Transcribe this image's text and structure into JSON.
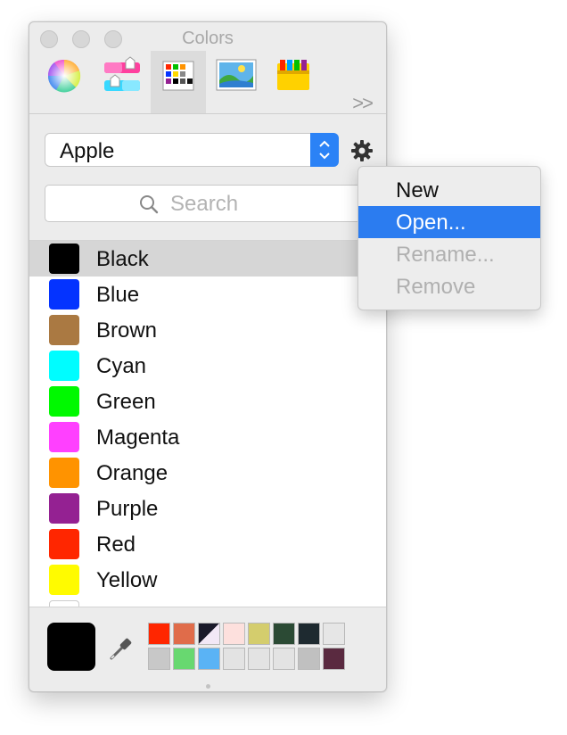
{
  "window": {
    "title": "Colors",
    "toolbar": {
      "tools": [
        "color-wheel",
        "color-sliders",
        "color-palettes",
        "image-palettes",
        "pencils"
      ],
      "active_tool": "color-palettes",
      "more_label": ">>"
    }
  },
  "palette_selector": {
    "selected": "Apple"
  },
  "search": {
    "placeholder": "Search"
  },
  "colors": [
    {
      "name": "Black",
      "hex": "#000000"
    },
    {
      "name": "Blue",
      "hex": "#0433ff"
    },
    {
      "name": "Brown",
      "hex": "#aa7942"
    },
    {
      "name": "Cyan",
      "hex": "#00fdff"
    },
    {
      "name": "Green",
      "hex": "#00f900"
    },
    {
      "name": "Magenta",
      "hex": "#ff40ff"
    },
    {
      "name": "Orange",
      "hex": "#ff9300"
    },
    {
      "name": "Purple",
      "hex": "#942192"
    },
    {
      "name": "Red",
      "hex": "#ff2600"
    },
    {
      "name": "Yellow",
      "hex": "#fffb00"
    }
  ],
  "selected_color": "Black",
  "current_color": "#000000",
  "swatches_row1": [
    "#ff2600",
    "#e06c4a",
    "diagonal",
    "#fde0dd",
    "#d4cd6d",
    "#2b4a34",
    "#1e2a30",
    "#e6e6e6"
  ],
  "swatches_row2": [
    "#c8c8c8",
    "#68d870",
    "#5ab3f5",
    "#e3e3e3",
    "#e3e3e3",
    "#e3e3e3",
    "#c0c0c0",
    "#5a2a40"
  ],
  "gear_menu": {
    "items": [
      {
        "label": "New",
        "state": "enabled"
      },
      {
        "label": "Open...",
        "state": "highlighted"
      },
      {
        "label": "Rename...",
        "state": "disabled"
      },
      {
        "label": "Remove",
        "state": "disabled"
      }
    ]
  },
  "accent_color": "#2b7cf0"
}
